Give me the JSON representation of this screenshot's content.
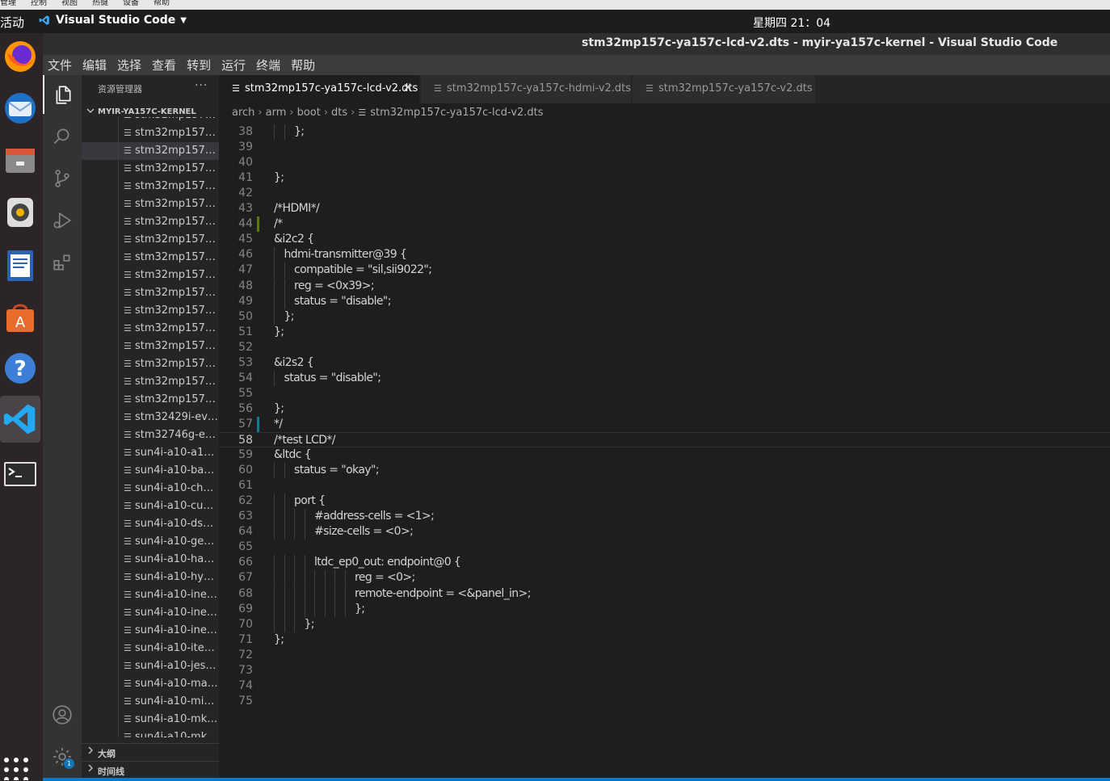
{
  "vm_menu": [
    "管理",
    "控制",
    "视图",
    "热键",
    "设备",
    "帮助"
  ],
  "gnome": {
    "activities": "活动",
    "app_name": "Visual Studio Code",
    "clock": "星期四 21：04"
  },
  "window": {
    "title": "stm32mp157c-ya157c-lcd-v2.dts - myir-ya157c-kernel - Visual Studio Code"
  },
  "menu": [
    "文件",
    "编辑",
    "选择",
    "查看",
    "转到",
    "运行",
    "终端",
    "帮助"
  ],
  "dock": [
    "firefox-icon",
    "thunderbird-icon",
    "files-icon",
    "rhythmbox-icon",
    "writer-icon",
    "software-icon",
    "help-icon",
    "vscode-icon",
    "terminal-icon"
  ],
  "explorer": {
    "header": "资源管理器",
    "more": "···",
    "section": "MYIR-YA157C-KERNEL",
    "files": [
      "stm32mp157c-...",
      "stm32mp157c-...",
      "stm32mp157c-...",
      "stm32mp157c-...",
      "stm32mp157c-...",
      "stm32mp157c-...",
      "stm32mp157c-...",
      "stm32mp157c-...",
      "stm32mp157c-...",
      "stm32mp157c-...",
      "stm32mp157c-...",
      "stm32mp157c....",
      "stm32mp157ca...",
      "stm32mp157ca...",
      "stm32mp157ca...",
      "stm32mp157ca...",
      "stm32mp157ca...",
      "stm32429i-eval...",
      "stm32746g-eva...",
      "sun4i-a10-a100...",
      "sun4i-a10-ba10...",
      "sun4i-a10-chu...",
      "sun4i-a10-cubi...",
      "sun4i-a10-dser...",
      "sun4i-a10-gem...",
      "sun4i-a10-hack...",
      "sun4i-a10-hyun...",
      "sun4i-a10-inet...",
      "sun4i-a10-inet...",
      "sun4i-a10-inet...",
      "sun4i-a10-itead...",
      "sun4i-a10-jesur...",
      "sun4i-a10-mars...",
      "sun4i-a10-mini-...",
      "sun4i-a10-mk8...",
      "sun4i-a10-mk8..."
    ],
    "selected_index": 2,
    "outline": "大纲",
    "timeline": "时间线"
  },
  "tabs": [
    {
      "label": "stm32mp157c-ya157c-lcd-v2.dts",
      "active": true
    },
    {
      "label": "stm32mp157c-ya157c-hdmi-v2.dts",
      "active": false
    },
    {
      "label": "stm32mp157c-ya157c-v2.dts",
      "active": false
    }
  ],
  "breadcrumb": [
    "arch",
    "arm",
    "boot",
    "dts",
    "stm32mp157c-ya157c-lcd-v2.dts"
  ],
  "settings_badge": "1",
  "editor": {
    "current_line": 58,
    "lines": [
      {
        "n": "38",
        "indent": 2,
        "text": "};"
      },
      {
        "n": "39",
        "indent": 0,
        "text": ""
      },
      {
        "n": "40",
        "indent": 0,
        "text": ""
      },
      {
        "n": "41",
        "indent": 0,
        "text": "};"
      },
      {
        "n": "42",
        "indent": 0,
        "text": ""
      },
      {
        "n": "43",
        "indent": 0,
        "text": "/*HDMI*/"
      },
      {
        "n": "44",
        "indent": 0,
        "text": "/*",
        "mark": "added"
      },
      {
        "n": "45",
        "indent": 0,
        "text": "&i2c2 {"
      },
      {
        "n": "46",
        "indent": 1,
        "text": "hdmi-transmitter@39 {"
      },
      {
        "n": "47",
        "indent": 2,
        "text": "compatible = \"sil,sii9022\";"
      },
      {
        "n": "48",
        "indent": 2,
        "text": "reg = <0x39>;"
      },
      {
        "n": "49",
        "indent": 2,
        "text": "status = \"disable\";"
      },
      {
        "n": "50",
        "indent": 1,
        "text": "};"
      },
      {
        "n": "51",
        "indent": 0,
        "text": "};"
      },
      {
        "n": "52",
        "indent": 0,
        "text": ""
      },
      {
        "n": "53",
        "indent": 0,
        "text": "&i2s2 {"
      },
      {
        "n": "54",
        "indent": 1,
        "text": "status = \"disable\";"
      },
      {
        "n": "55",
        "indent": 0,
        "text": ""
      },
      {
        "n": "56",
        "indent": 0,
        "text": "};"
      },
      {
        "n": "57",
        "indent": 0,
        "text": "*/",
        "mark": "modified"
      },
      {
        "n": "58",
        "indent": 0,
        "text": "/*test LCD*/"
      },
      {
        "n": "59",
        "indent": 0,
        "text": "&ltdc {"
      },
      {
        "n": "60",
        "indent": 2,
        "text": "status = \"okay\";"
      },
      {
        "n": "61",
        "indent": 0,
        "text": ""
      },
      {
        "n": "62",
        "indent": 2,
        "text": "port {"
      },
      {
        "n": "63",
        "indent": 4,
        "text": "#address-cells = <1>;"
      },
      {
        "n": "64",
        "indent": 4,
        "text": "#size-cells = <0>;"
      },
      {
        "n": "65",
        "indent": 0,
        "text": ""
      },
      {
        "n": "66",
        "indent": 4,
        "text": "ltdc_ep0_out: endpoint@0 {"
      },
      {
        "n": "67",
        "indent": 8,
        "text": "reg = <0>;"
      },
      {
        "n": "68",
        "indent": 8,
        "text": "remote-endpoint = <&panel_in>;"
      },
      {
        "n": "69",
        "indent": 8,
        "text": "};"
      },
      {
        "n": "70",
        "indent": 3,
        "text": "};"
      },
      {
        "n": "71",
        "indent": 0,
        "text": "};"
      },
      {
        "n": "72",
        "indent": 0,
        "text": ""
      },
      {
        "n": "73",
        "indent": 0,
        "text": ""
      },
      {
        "n": "74",
        "indent": 0,
        "text": ""
      },
      {
        "n": "75",
        "indent": 0,
        "text": ""
      }
    ]
  },
  "colors": {
    "accent": "#007acc",
    "added": "#587c0c",
    "modified": "#0c7d9d"
  }
}
